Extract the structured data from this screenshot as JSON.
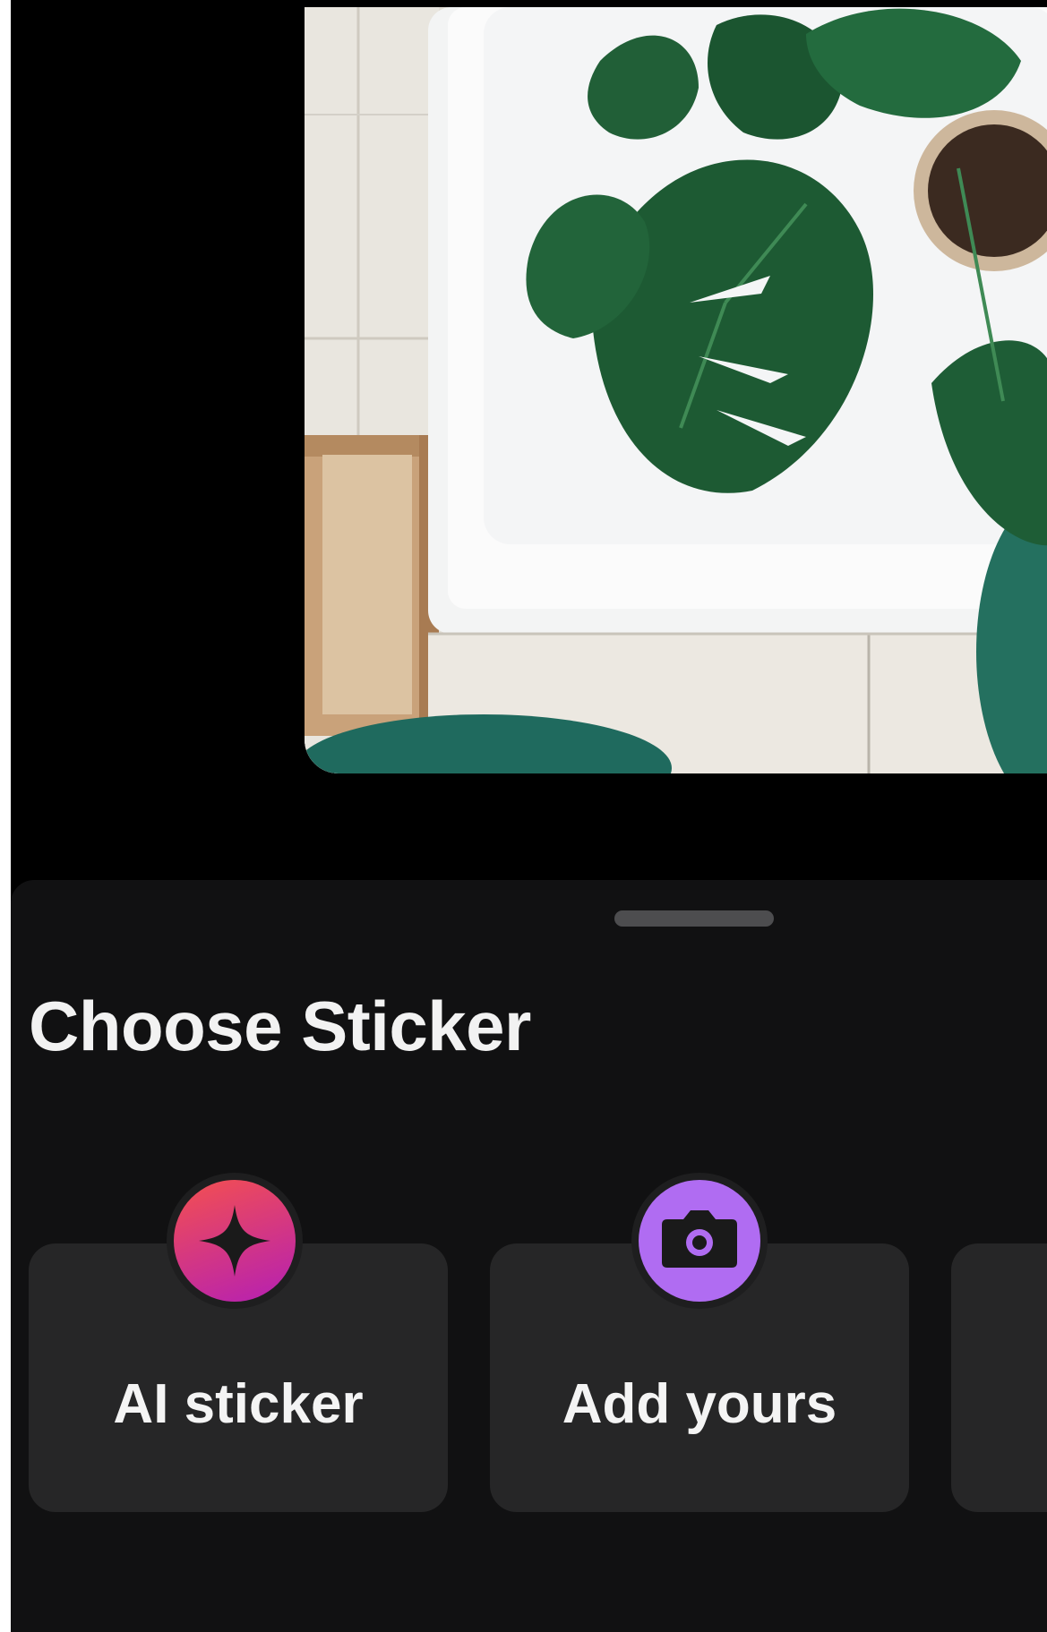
{
  "sheet": {
    "title": "Choose Sticker"
  },
  "stickers": [
    {
      "label": "AI sticker",
      "icon": "sparkle-icon",
      "gradient": [
        "#f4504f",
        "#b51fb4"
      ]
    },
    {
      "label": "Add yours",
      "icon": "camera-icon",
      "color": "#b06cf2"
    },
    {
      "label": "",
      "icon": ""
    }
  ],
  "colors": {
    "sheet_background": "#111112",
    "card_background": "#262627",
    "text": "#f2f2f2"
  }
}
